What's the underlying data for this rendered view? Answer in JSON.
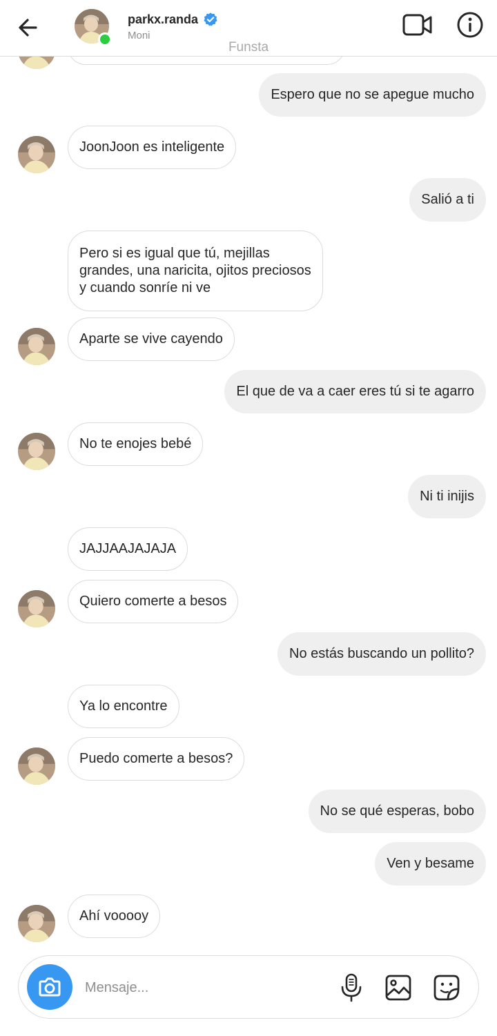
{
  "header": {
    "username": "parkx.randa",
    "subname": "Moni",
    "overlay_label": "Funsta",
    "verified": true,
    "online": true
  },
  "messages": [
    {
      "from": "me",
      "text": "Espero que no se apegue mucho"
    },
    {
      "from": "them",
      "text": "JoonJoon es inteligente"
    },
    {
      "from": "me",
      "text": "Salió a ti"
    },
    {
      "from": "them",
      "text": "Pero si es igual que tú, mejillas\ngrandes, una naricita, ojitos preciosos\ny cuando sonríe ni ve"
    },
    {
      "from": "them",
      "text": "Aparte se vive cayendo"
    },
    {
      "from": "me",
      "text": "El que de va a caer eres tú si te agarro"
    },
    {
      "from": "them",
      "text": "No te enojes bebé"
    },
    {
      "from": "me",
      "text": "Ni ti inijis"
    },
    {
      "from": "them",
      "text": "JAJJAAJAJAJA"
    },
    {
      "from": "them",
      "text": "Quiero comerte a besos"
    },
    {
      "from": "me",
      "text": "No estás buscando un pollito?"
    },
    {
      "from": "them",
      "text": "Ya lo encontre"
    },
    {
      "from": "them",
      "text": "Puedo comerte a besos?"
    },
    {
      "from": "me",
      "text": "No se qué esperas, bobo"
    },
    {
      "from": "me",
      "text": "Ven y besame"
    },
    {
      "from": "them",
      "text": "Ahí vooooy"
    }
  ],
  "composer": {
    "placeholder": "Mensaje..."
  },
  "icons": {
    "back": "arrow-left-icon",
    "verified": "verified-badge-icon",
    "video": "video-camera-icon",
    "info": "info-icon",
    "camera": "camera-icon",
    "mic": "microphone-icon",
    "gallery": "image-gallery-icon",
    "sticker": "sticker-icon"
  },
  "colors": {
    "accent_blue": "#3897f0",
    "online_green": "#2ecc40",
    "outgoing_bubble": "#efefef",
    "border": "#dbdbdb",
    "muted_text": "#8e8e8e"
  }
}
